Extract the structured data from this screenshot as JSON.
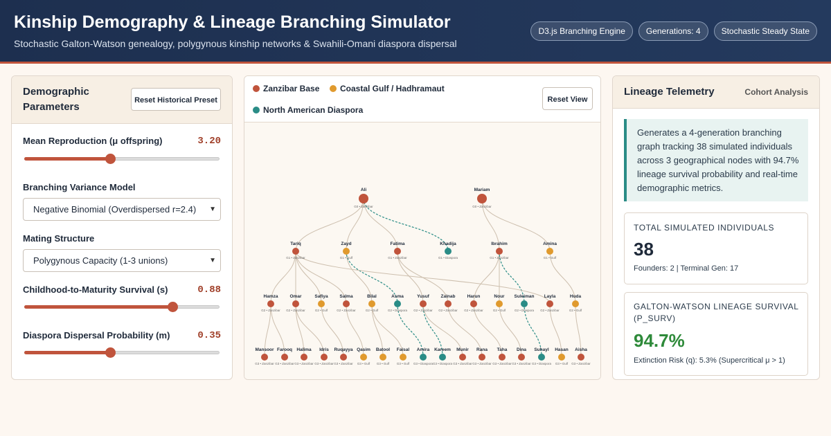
{
  "header": {
    "title": "Kinship Demography & Lineage Branching Simulator",
    "subtitle": "Stochastic Galton-Watson genealogy, polygynous kinship networks & Swahili-Omani diaspora dispersal",
    "badges": [
      "D3.js Branching Engine",
      "Generations: 4",
      "Stochastic Steady State"
    ]
  },
  "left_panel": {
    "title": "Demographic Parameters",
    "reset_button": "Reset Historical Preset",
    "mean_reproduction": {
      "label": "Mean Reproduction (μ offspring)",
      "value": "3.20",
      "fraction": 0.44
    },
    "variance_model": {
      "label": "Branching Variance Model",
      "selected": "Negative Binomial (Overdispersed r=2.4)"
    },
    "mating_structure": {
      "label": "Mating Structure",
      "selected": "Polygynous Capacity (1-3 unions)"
    },
    "childhood_survival": {
      "label": "Childhood-to-Maturity Survival (s)",
      "value": "0.88",
      "fraction": 0.76
    },
    "diaspora_dispersal": {
      "label": "Diaspora Dispersal Probability (m)",
      "value": "0.35",
      "fraction": 0.44
    }
  },
  "center_panel": {
    "legend": [
      {
        "label": "Zanzibar Base",
        "color": "#c0543c"
      },
      {
        "label": "Coastal Gulf / Hadhramaut",
        "color": "#e09a2e"
      },
      {
        "label": "North American Diaspora",
        "color": "#2a8c86"
      }
    ],
    "reset_button": "Reset View",
    "node_colors": {
      "Zanzibar": "#c0543c",
      "Gulf": "#e09a2e",
      "Diaspora": "#2a8c86"
    },
    "generations": [
      [
        {
          "name": "Ali",
          "region": "Zanzibar",
          "sub": "G0 • Zanzibar"
        },
        {
          "name": "Mariam",
          "region": "Zanzibar",
          "sub": "G0 • Zanzibar"
        }
      ],
      [
        {
          "name": "Tariq",
          "region": "Zanzibar",
          "sub": "G1 • Zanzibar",
          "parent": 0
        },
        {
          "name": "Zayd",
          "region": "Gulf",
          "sub": "G1 • Gulf",
          "parent": 0
        },
        {
          "name": "Fatima",
          "region": "Zanzibar",
          "sub": "G1 • Zanzibar",
          "parent": 0
        },
        {
          "name": "Khadija",
          "region": "Diaspora",
          "sub": "G1 • Diaspora",
          "parent": 0
        },
        {
          "name": "Ibrahim",
          "region": "Zanzibar",
          "sub": "G1 • Zanzibar",
          "parent": 1
        },
        {
          "name": "Amina",
          "region": "Gulf",
          "sub": "G1 • Gulf",
          "parent": 1
        }
      ],
      [
        {
          "name": "Hamza",
          "region": "Zanzibar",
          "sub": "G2 • Zanzibar",
          "parent": 0
        },
        {
          "name": "Omar",
          "region": "Zanzibar",
          "sub": "G2 • Zanzibar",
          "parent": 0
        },
        {
          "name": "Safiya",
          "region": "Gulf",
          "sub": "G2 • Gulf",
          "parent": 0
        },
        {
          "name": "Salma",
          "region": "Zanzibar",
          "sub": "G2 • Zanzibar",
          "parent": 0
        },
        {
          "name": "Bilal",
          "region": "Gulf",
          "sub": "G2 • Gulf",
          "parent": 1
        },
        {
          "name": "Asma",
          "region": "Diaspora",
          "sub": "G2 • Diaspora",
          "parent": 1
        },
        {
          "name": "Yusuf",
          "region": "Zanzibar",
          "sub": "G2 • Zanzibar",
          "parent": 2
        },
        {
          "name": "Zainab",
          "region": "Zanzibar",
          "sub": "G2 • Zanzibar",
          "parent": 2
        },
        {
          "name": "Harun",
          "region": "Zanzibar",
          "sub": "G2 • Zanzibar",
          "parent": 4
        },
        {
          "name": "Nour",
          "region": "Gulf",
          "sub": "G2 • Gulf",
          "parent": 4
        },
        {
          "name": "Suleiman",
          "region": "Diaspora",
          "sub": "G2 • Diaspora",
          "parent": 4
        },
        {
          "name": "Layla",
          "region": "Zanzibar",
          "sub": "G2 • Zanzibar",
          "parent": 0
        },
        {
          "name": "Huda",
          "region": "Gulf",
          "sub": "G2 • Gulf",
          "parent": 5
        }
      ],
      [
        {
          "name": "Mansoor",
          "region": "Zanzibar",
          "sub": "G3 • Zanzibar",
          "parent": 0
        },
        {
          "name": "Farooq",
          "region": "Zanzibar",
          "sub": "G3 • Zanzibar",
          "parent": 0
        },
        {
          "name": "Halima",
          "region": "Zanzibar",
          "sub": "G3 • Zanzibar",
          "parent": 1
        },
        {
          "name": "Idris",
          "region": "Zanzibar",
          "sub": "G3 • Zanzibar",
          "parent": 1
        },
        {
          "name": "Ruqayya",
          "region": "Zanzibar",
          "sub": "G3 • Zanzibar",
          "parent": 2
        },
        {
          "name": "Qasim",
          "region": "Gulf",
          "sub": "G3 • Gulf",
          "parent": 3
        },
        {
          "name": "Batool",
          "region": "Gulf",
          "sub": "G3 • Gulf",
          "parent": 4
        },
        {
          "name": "Faisal",
          "region": "Gulf",
          "sub": "G3 • Gulf",
          "parent": 4
        },
        {
          "name": "Amira",
          "region": "Diaspora",
          "sub": "G3 • Diaspora",
          "parent": 5
        },
        {
          "name": "Kareem",
          "region": "Diaspora",
          "sub": "G3 • Diaspora",
          "parent": 6
        },
        {
          "name": "Munir",
          "region": "Zanzibar",
          "sub": "G3 • Zanzibar",
          "parent": 6
        },
        {
          "name": "Rana",
          "region": "Zanzibar",
          "sub": "G3 • Zanzibar",
          "parent": 7
        },
        {
          "name": "Taha",
          "region": "Zanzibar",
          "sub": "G3 • Zanzibar",
          "parent": 8
        },
        {
          "name": "Dina",
          "region": "Zanzibar",
          "sub": "G3 • Zanzibar",
          "parent": 9
        },
        {
          "name": "Suhayl",
          "region": "Diaspora",
          "sub": "G3 • Diaspora",
          "parent": 10
        },
        {
          "name": "Hasan",
          "region": "Gulf",
          "sub": "G3 • Gulf",
          "parent": 11
        },
        {
          "name": "Aisha",
          "region": "Zanzibar",
          "sub": "G3 • Zanzibar",
          "parent": 12
        }
      ]
    ]
  },
  "right_panel": {
    "title": "Lineage Telemetry",
    "link": "Cohort Analysis",
    "description": "Generates a 4-generation branching graph tracking 38 simulated individuals across 3 geographical nodes with 94.7% lineage survival probability and real-time demographic metrics.",
    "total": {
      "label": "TOTAL SIMULATED INDIVIDUALS",
      "value": "38",
      "sub": "Founders: 2 | Terminal Gen: 17",
      "color": "#1f2a3a"
    },
    "survival": {
      "label": "GALTON-WATSON LINEAGE SURVIVAL (P_SURV)",
      "value": "94.7%",
      "sub": "Extinction Risk (q): 5.3% (Supercritical μ > 1)",
      "color": "#2e8a3a"
    }
  }
}
